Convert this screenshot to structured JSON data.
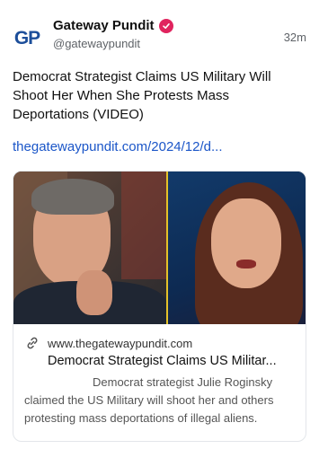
{
  "author": {
    "avatar_text_g": "G",
    "avatar_text_p": "P",
    "display_name": "Gateway Pundit",
    "handle": "@gatewaypundit",
    "verified_color": "#e0245e",
    "brand_color": "#1c4e9a"
  },
  "post": {
    "timestamp": "32m",
    "text": "Democrat Strategist Claims US Military Will Shoot Her When She Protests Mass Deportations (VIDEO)",
    "link_text": "thegatewaypundit.com/2024/12/d..."
  },
  "card": {
    "domain": "www.thegatewaypundit.com",
    "title": "Democrat Strategist Claims US Militar...",
    "description": "Democrat strategist Julie Roginsky claimed the US Military will shoot her and others protesting mass deportations of illegal aliens.",
    "link_icon": "link-icon",
    "image_icon": "video-thumbnail-image"
  }
}
